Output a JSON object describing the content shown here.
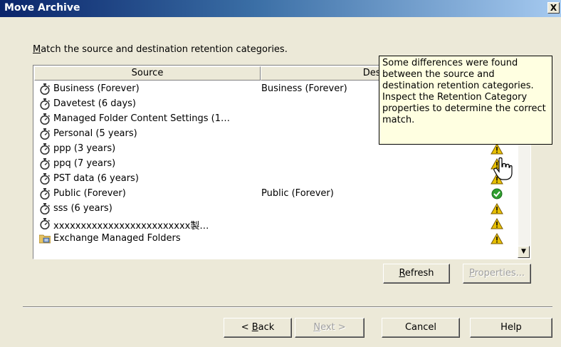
{
  "window": {
    "title": "Move Archive",
    "close_label": "X"
  },
  "instruction": {
    "accel": "M",
    "rest": "atch the source and destination retention categories."
  },
  "columns": {
    "source": "Source",
    "destination": "Destination"
  },
  "rows": [
    {
      "icon": "stopwatch-icon",
      "source": "Business (Forever)",
      "destination": "Business (Forever)",
      "status": "warning"
    },
    {
      "icon": "stopwatch-icon",
      "source": "Davetest (6 days)",
      "destination": "",
      "status": "warning"
    },
    {
      "icon": "stopwatch-icon",
      "source": "Managed Folder Content Settings (1…",
      "destination": "",
      "status": "warning"
    },
    {
      "icon": "stopwatch-icon",
      "source": "Personal (5 years)",
      "destination": "",
      "status": "warning"
    },
    {
      "icon": "stopwatch-icon",
      "source": "ppp (3 years)",
      "destination": "",
      "status": "warning"
    },
    {
      "icon": "stopwatch-icon",
      "source": "ppq (7 years)",
      "destination": "",
      "status": "warning"
    },
    {
      "icon": "stopwatch-icon",
      "source": "PST data (6 years)",
      "destination": "",
      "status": "warning"
    },
    {
      "icon": "stopwatch-icon",
      "source": "Public (Forever)",
      "destination": "Public (Forever)",
      "status": "ok"
    },
    {
      "icon": "stopwatch-icon",
      "source": "sss (6 years)",
      "destination": "",
      "status": "warning"
    },
    {
      "icon": "stopwatch-icon",
      "source": "xxxxxxxxxxxxxxxxxxxxxxxxx製…",
      "destination": "",
      "status": "warning"
    },
    {
      "icon": "folder-icon",
      "source": "Exchange Managed Folders",
      "destination": "",
      "status": "warning"
    }
  ],
  "tooltip": {
    "text": "Some differences were found between the source and destination retention categories. Inspect the Retention Category properties to determine the correct match."
  },
  "buttons": {
    "refresh": {
      "accel": "R",
      "rest": "efresh"
    },
    "properties": {
      "accel": "P",
      "rest": "roperties..."
    },
    "back": {
      "pre": "< ",
      "accel": "B",
      "rest": "ack"
    },
    "next": {
      "accel": "N",
      "rest": "ext >"
    },
    "cancel": "Cancel",
    "help": "Help"
  },
  "colors": {
    "warning": "#e8c000",
    "ok": "#2e9e2e",
    "title_start": "#0a246a",
    "title_end": "#a6caf0",
    "tooltip_bg": "#ffffe1"
  }
}
